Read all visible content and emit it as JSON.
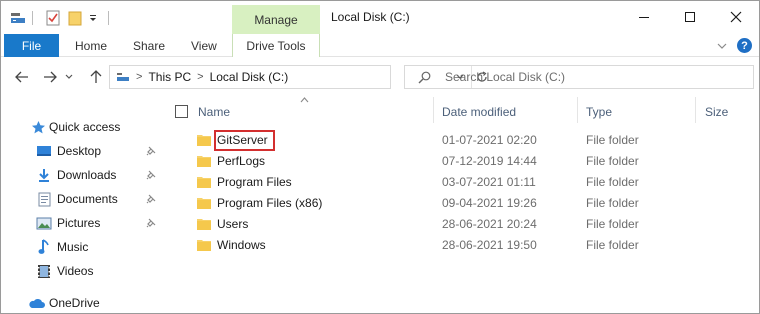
{
  "window": {
    "title": "Local Disk (C:)",
    "context_tab": "Manage"
  },
  "ribbon": {
    "file": "File",
    "tabs": [
      "Home",
      "Share",
      "View"
    ],
    "context_tab": "Drive Tools"
  },
  "address": {
    "segments": [
      "This PC",
      "Local Disk (C:)"
    ],
    "search_placeholder": "Search Local Disk (C:)"
  },
  "nav": {
    "quick_access": "Quick access",
    "items": [
      {
        "label": "Desktop",
        "icon": "desktop-icon",
        "pinned": true
      },
      {
        "label": "Downloads",
        "icon": "downloads-icon",
        "pinned": true
      },
      {
        "label": "Documents",
        "icon": "documents-icon",
        "pinned": true
      },
      {
        "label": "Pictures",
        "icon": "pictures-icon",
        "pinned": true
      },
      {
        "label": "Music",
        "icon": "music-icon",
        "pinned": false
      },
      {
        "label": "Videos",
        "icon": "videos-icon",
        "pinned": false
      }
    ],
    "onedrive": "OneDrive"
  },
  "columns": {
    "name": "Name",
    "date": "Date modified",
    "type": "Type",
    "size": "Size"
  },
  "files": [
    {
      "name": "GitServer",
      "date": "01-07-2021 02:20",
      "type": "File folder",
      "highlighted": true
    },
    {
      "name": "PerfLogs",
      "date": "07-12-2019 14:44",
      "type": "File folder",
      "highlighted": false
    },
    {
      "name": "Program Files",
      "date": "03-07-2021 01:11",
      "type": "File folder",
      "highlighted": false
    },
    {
      "name": "Program Files (x86)",
      "date": "09-04-2021 19:26",
      "type": "File folder",
      "highlighted": false
    },
    {
      "name": "Users",
      "date": "28-06-2021 20:24",
      "type": "File folder",
      "highlighted": false
    },
    {
      "name": "Windows",
      "date": "28-06-2021 19:50",
      "type": "File folder",
      "highlighted": false
    }
  ],
  "colors": {
    "file_tab": "#1979ca",
    "manage_tab": "#d8f0c1",
    "folder": "#f7d26a",
    "highlight": "#d32f2f"
  }
}
